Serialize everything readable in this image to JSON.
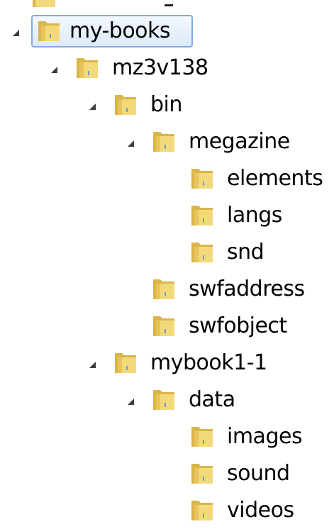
{
  "tree": {
    "items": [
      {
        "label": "my-books",
        "level": 0,
        "expanded": true,
        "selected": true
      },
      {
        "label": "mz3v138",
        "level": 1,
        "expanded": true
      },
      {
        "label": "bin",
        "level": 2,
        "expanded": true
      },
      {
        "label": "megazine",
        "level": 3,
        "expanded": true
      },
      {
        "label": "elements",
        "level": 4,
        "expanded": false
      },
      {
        "label": "langs",
        "level": 4,
        "expanded": false
      },
      {
        "label": "snd",
        "level": 4,
        "expanded": false
      },
      {
        "label": "swfaddress",
        "level": 3,
        "expanded": false
      },
      {
        "label": "swfobject",
        "level": 3,
        "expanded": false
      },
      {
        "label": "mybook1-1",
        "level": 2,
        "expanded": true
      },
      {
        "label": "data",
        "level": 3,
        "expanded": true
      },
      {
        "label": "images",
        "level": 4,
        "expanded": false
      },
      {
        "label": "sound",
        "level": 4,
        "expanded": false
      },
      {
        "label": "videos",
        "level": 4,
        "expanded": false
      }
    ]
  },
  "colors": {
    "selection_border": "#84acdd",
    "folder_front": "#f3d97a",
    "folder_back": "#d9b54a"
  },
  "icons": {
    "folder": "folder-icon",
    "expanded_arrow": "expanded-arrow-icon"
  }
}
